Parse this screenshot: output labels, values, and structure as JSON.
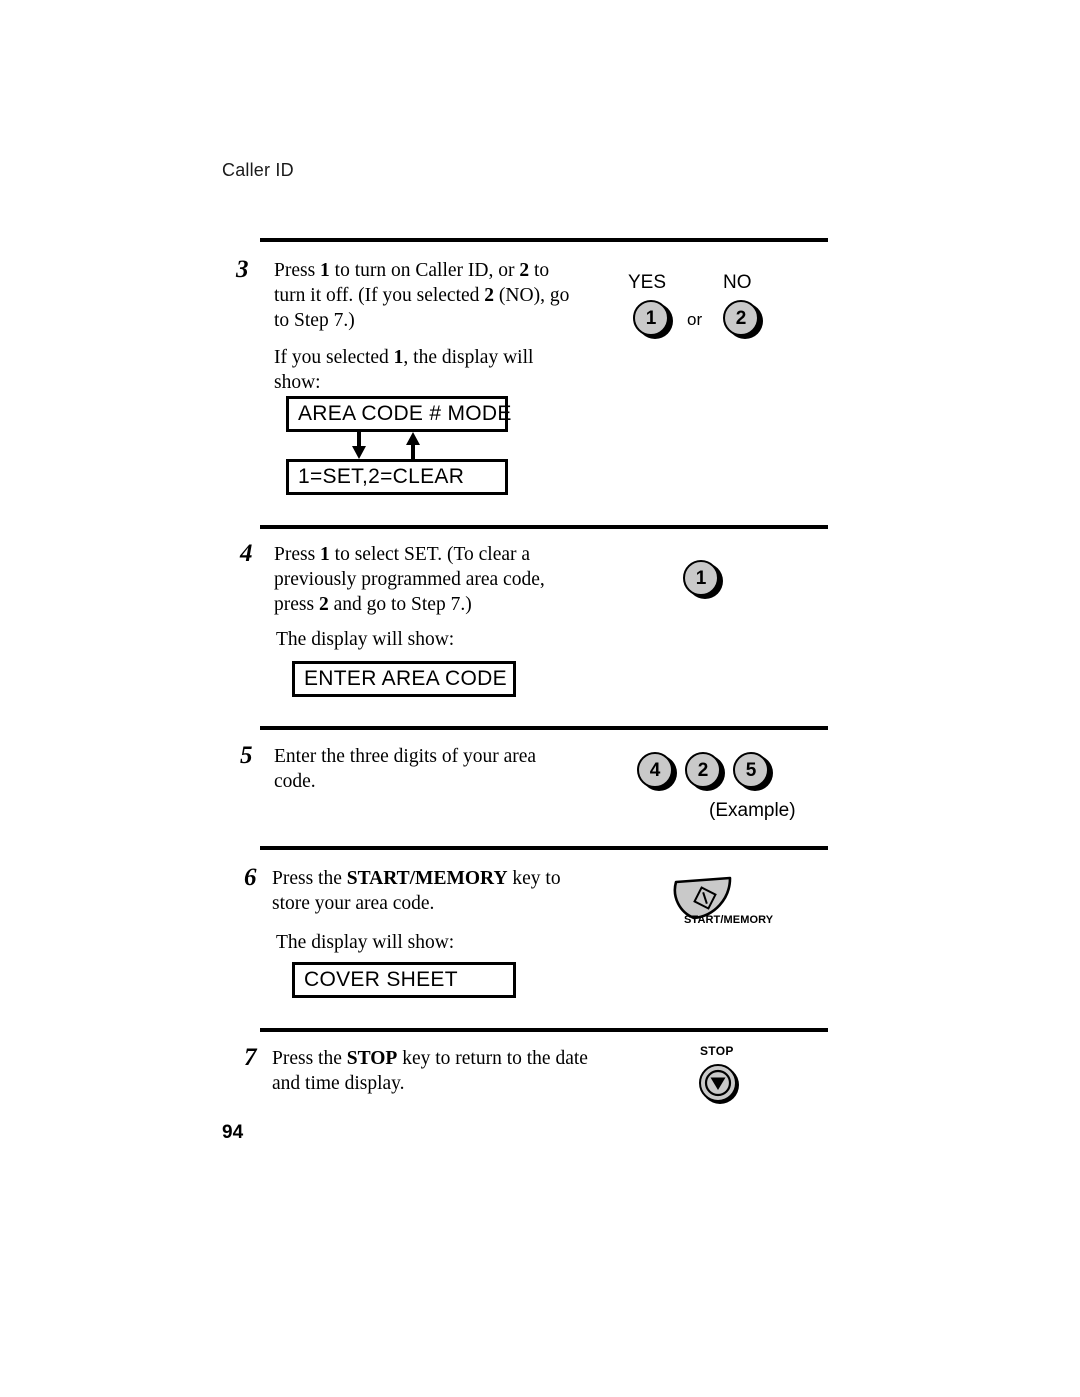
{
  "document": {
    "running_header": "Caller ID",
    "page_number": "94",
    "colors": {
      "ink": "#000000",
      "paper": "#ffffff",
      "key_face": "#c9c9c9",
      "key_shadow": "#000000"
    }
  },
  "steps": [
    {
      "number": "3",
      "text_parts": [
        {
          "t": "Press ",
          "b": false
        },
        {
          "t": "1",
          "b": true
        },
        {
          "t": " to turn on Caller ID, or ",
          "b": false
        },
        {
          "t": "2",
          "b": true
        },
        {
          "t": " to turn it off. (If you selected ",
          "b": false
        },
        {
          "t": "2",
          "b": true
        },
        {
          "t": " (NO), go to Step 7.)",
          "b": false
        }
      ],
      "text_plain": "Press 1 to turn on Caller ID, or 2 to turn it off. (If you selected 2 (NO), go to Step 7.)",
      "note_parts": [
        {
          "t": "If you selected ",
          "b": false
        },
        {
          "t": "1",
          "b": true
        },
        {
          "t": ", the display will show:",
          "b": false
        }
      ],
      "note_plain": "If you selected 1, the display will show:",
      "keys": [
        {
          "caption": "YES",
          "label": "1"
        },
        {
          "connector": "or"
        },
        {
          "caption": "NO",
          "label": "2"
        }
      ],
      "displays": [
        "AREA CODE # MODE",
        "1=SET,2=CLEAR"
      ],
      "arrows": [
        "down",
        "up"
      ]
    },
    {
      "number": "4",
      "text_parts": [
        {
          "t": "Press ",
          "b": false
        },
        {
          "t": "1",
          "b": true
        },
        {
          "t": " to select SET. (To clear a previously programmed area code, press ",
          "b": false
        },
        {
          "t": "2",
          "b": true
        },
        {
          "t": " and go to Step 7.)",
          "b": false
        }
      ],
      "text_plain": "Press 1 to select SET. (To clear a previously programmed area code, press 2 and go to Step 7.)",
      "note_plain": "The display will show:",
      "keys": [
        {
          "label": "1"
        }
      ],
      "displays": [
        "ENTER AREA CODE"
      ]
    },
    {
      "number": "5",
      "text_plain": "Enter the three digits of your area code.",
      "keys": [
        {
          "label": "4"
        },
        {
          "label": "2"
        },
        {
          "label": "5"
        }
      ],
      "example_caption": "(Example)"
    },
    {
      "number": "6",
      "text_parts": [
        {
          "t": "Press the ",
          "b": false
        },
        {
          "t": "START/MEMORY",
          "b": true
        },
        {
          "t": " key to store your area code.",
          "b": false
        }
      ],
      "text_plain": "Press the START/MEMORY key to store your area code.",
      "note_plain": "The display will show:",
      "hardware_key": {
        "icon": "start-memory-key-icon",
        "label": "START/MEMORY"
      },
      "displays": [
        "COVER SHEET"
      ]
    },
    {
      "number": "7",
      "text_parts": [
        {
          "t": "Press the ",
          "b": false
        },
        {
          "t": "STOP",
          "b": true
        },
        {
          "t": " key to return to the date and time display.",
          "b": false
        }
      ],
      "text_plain": "Press the STOP key to return to the date and time display.",
      "hardware_key": {
        "icon": "stop-key-icon",
        "label": "STOP"
      }
    }
  ]
}
